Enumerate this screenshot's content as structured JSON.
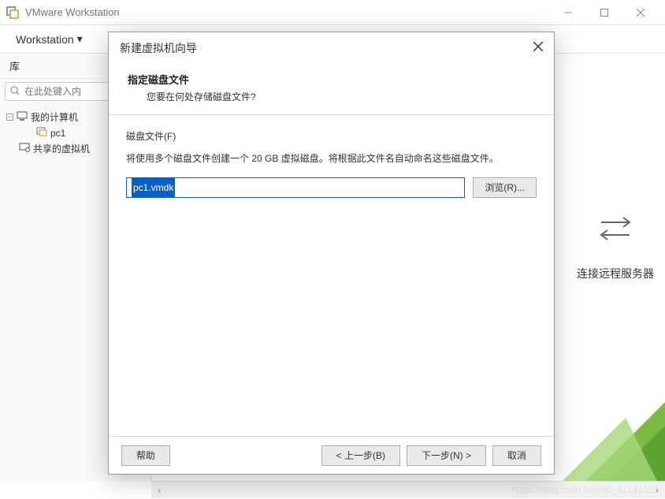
{
  "titlebar": {
    "app_title": "VMware Workstation"
  },
  "menubar": {
    "workstation": "Workstation"
  },
  "sidebar": {
    "header": "库",
    "search_placeholder": "在此处键入内",
    "tree": {
      "root": "我的计算机",
      "pc": "pc1",
      "shared": "共享的虚拟机"
    }
  },
  "content": {
    "connect_remote": "连接远程服务器"
  },
  "modal": {
    "title": "新建虚拟机向导",
    "heading": "指定磁盘文件",
    "subheading": "您要在何处存储磁盘文件?",
    "file_label": "磁盘文件(F)",
    "desc": "将使用多个磁盘文件创建一个 20 GB 虚拟磁盘。将根据此文件名自动命名这些磁盘文件。",
    "filename": "pc1.vmdk",
    "browse": "浏览(R)...",
    "help": "帮助",
    "back": "< 上一步(B)",
    "next": "下一步(N) >",
    "cancel": "取消"
  },
  "watermark": "https://blog.csdn.net/m0_51141557"
}
